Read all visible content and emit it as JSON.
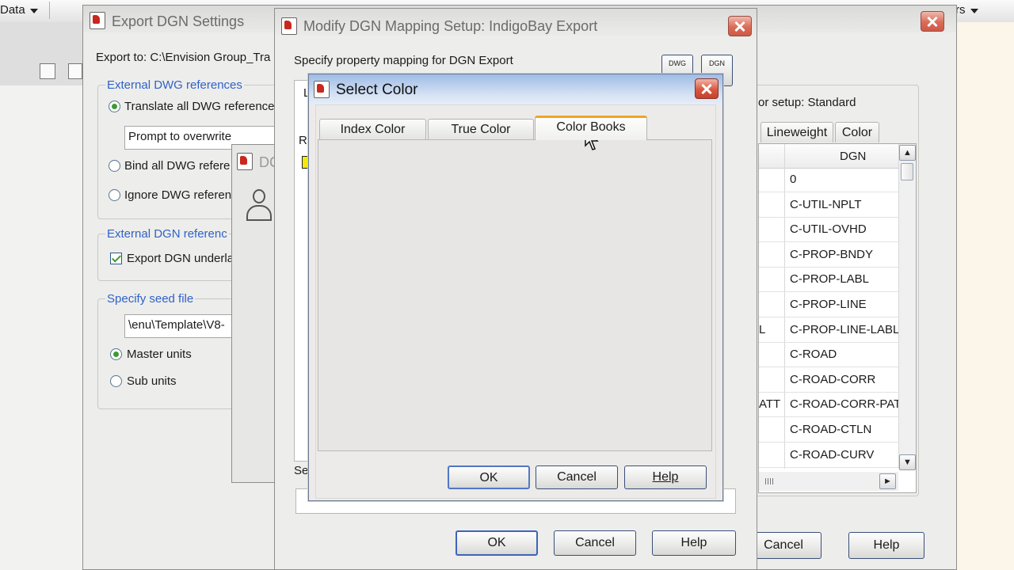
{
  "bg_app": {
    "data_menu": "Data",
    "right_menu_fragment": "rs"
  },
  "export_dialog": {
    "title": "Export DGN Settings",
    "export_to_label": "Export to: C:\\Envision Group_Tra",
    "ext_dwg_legend": "External DWG references",
    "opt_translate": "Translate all DWG reference",
    "overwrite_value": "Prompt to overwrite",
    "opt_bind": "Bind all DWG refere",
    "opt_ignore": "Ignore DWG referen",
    "ext_dgn_legend": "External DGN referenc",
    "export_underlay": "Export DGN underla",
    "seed_legend": "Specify seed file",
    "seed_value": "\\enu\\Template\\V8-",
    "master_units": "Master units",
    "sub_units": "Sub units",
    "cancel": "Cancel",
    "help": "Help"
  },
  "mid_dialog": {
    "title_fragment": "DC"
  },
  "mapping_dialog": {
    "title": "Modify DGN Mapping Setup: IndigoBay Export",
    "instruction": "Specify property mapping for DGN Export",
    "dwg_btn": "DWG",
    "dgn_btn": "DGN",
    "color_setup": "or setup: Standard",
    "tabs": [
      "Lineweight",
      "Color"
    ],
    "col_dgn": "DGN",
    "left_tab_fragment": "L",
    "left_row_fragment": "R",
    "left_bottom_fragment": "Se",
    "dgn_layers": [
      "0",
      "C-UTIL-NPLT",
      "C-UTIL-OVHD",
      "C-PROP-BNDY",
      "C-PROP-LABL",
      "C-PROP-LINE",
      "C-PROP-LINE-LABL",
      "C-ROAD",
      "C-ROAD-CORR",
      "C-ROAD-CORR-PAT",
      "C-ROAD-CTLN",
      "C-ROAD-CURV"
    ],
    "dwg_fragments": [
      "",
      "",
      "",
      "",
      "",
      "",
      "L",
      "",
      "",
      "ATT",
      "",
      ""
    ],
    "ok": "OK",
    "cancel": "Cancel",
    "help": "Help"
  },
  "select_color": {
    "title": "Select Color",
    "tabs": [
      "Index Color",
      "True Color",
      "Color Books"
    ],
    "active_tab": "Color Books",
    "ok": "OK",
    "cancel": "Cancel",
    "help": "Help"
  },
  "colors": {
    "title_blue_top": "#a6c2e8",
    "title_blue_bottom": "#dfe8f5",
    "close_red": "#d9573f",
    "active_tab_accent": "#f0a524",
    "legend_blue": "#2f62c9",
    "layer_swatch": "#f4e90b"
  }
}
